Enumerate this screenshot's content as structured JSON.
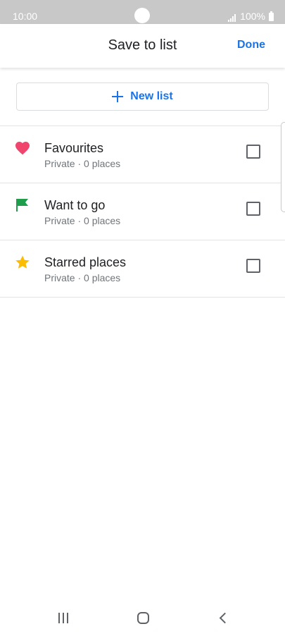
{
  "status_bar": {
    "time": "10:00",
    "battery": "100%"
  },
  "app_bar": {
    "title": "Save to list",
    "done_label": "Done"
  },
  "new_list": {
    "label": "New list"
  },
  "lists": [
    {
      "title": "Favourites",
      "subtitle": "Private · 0 places",
      "icon": "heart-icon",
      "icon_color": "#f0466d",
      "checked": false
    },
    {
      "title": "Want to go",
      "subtitle": "Private · 0 places",
      "icon": "flag-icon",
      "icon_color": "#1e9e4a",
      "checked": false
    },
    {
      "title": "Starred places",
      "subtitle": "Private · 0 places",
      "icon": "star-icon",
      "icon_color": "#fbbc04",
      "checked": false
    }
  ],
  "colors": {
    "accent": "#1a73e8",
    "text_primary": "#202124",
    "text_secondary": "#70757a"
  }
}
